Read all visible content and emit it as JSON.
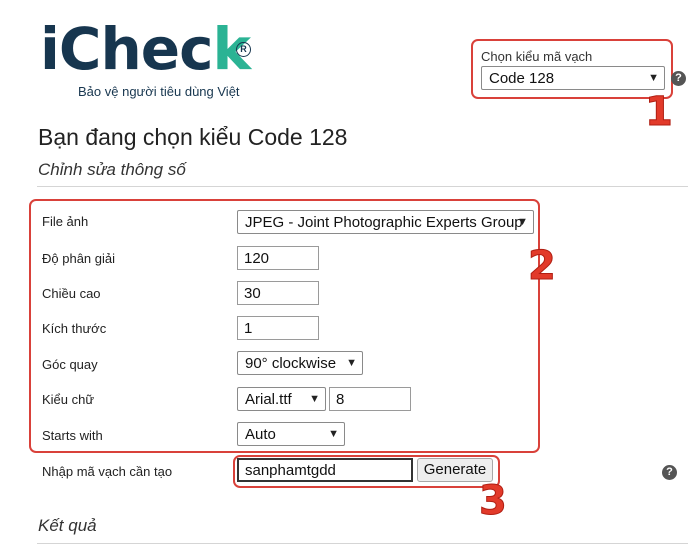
{
  "logo": {
    "brand_main": "iChec",
    "brand_accent": "k",
    "registered": "R",
    "tagline": "Bảo vệ người tiêu dùng Việt"
  },
  "barcode_type": {
    "label": "Chọn kiểu mã vạch",
    "selected": "Code 128",
    "help": "?"
  },
  "annotations": {
    "step1": "1",
    "step2": "2",
    "step3": "3"
  },
  "heading": "Bạn đang chọn kiểu Code 128",
  "subheading": "Chỉnh sửa thông số",
  "form": {
    "file_label": "File ảnh",
    "file_value": "JPEG - Joint Photographic Experts Group",
    "resolution_label": "Độ phân giải",
    "resolution_value": "120",
    "height_label": "Chiều cao",
    "height_value": "30",
    "size_label": "Kích thước",
    "size_value": "1",
    "rotation_label": "Góc quay",
    "rotation_value": "90° clockwise",
    "font_label": "Kiểu chữ",
    "font_value": "Arial.ttf",
    "font_size_value": "8",
    "starts_label": "Starts with",
    "starts_value": "Auto"
  },
  "input_section": {
    "label": "Nhập mã vạch cần tạo",
    "value": "sanphamtgdd",
    "generate_label": "Generate",
    "help": "?"
  },
  "result_heading": "Kết quả",
  "colors": {
    "brand_dark": "#17364f",
    "brand_green": "#2bb394",
    "annotation_red": "#d9413a"
  }
}
